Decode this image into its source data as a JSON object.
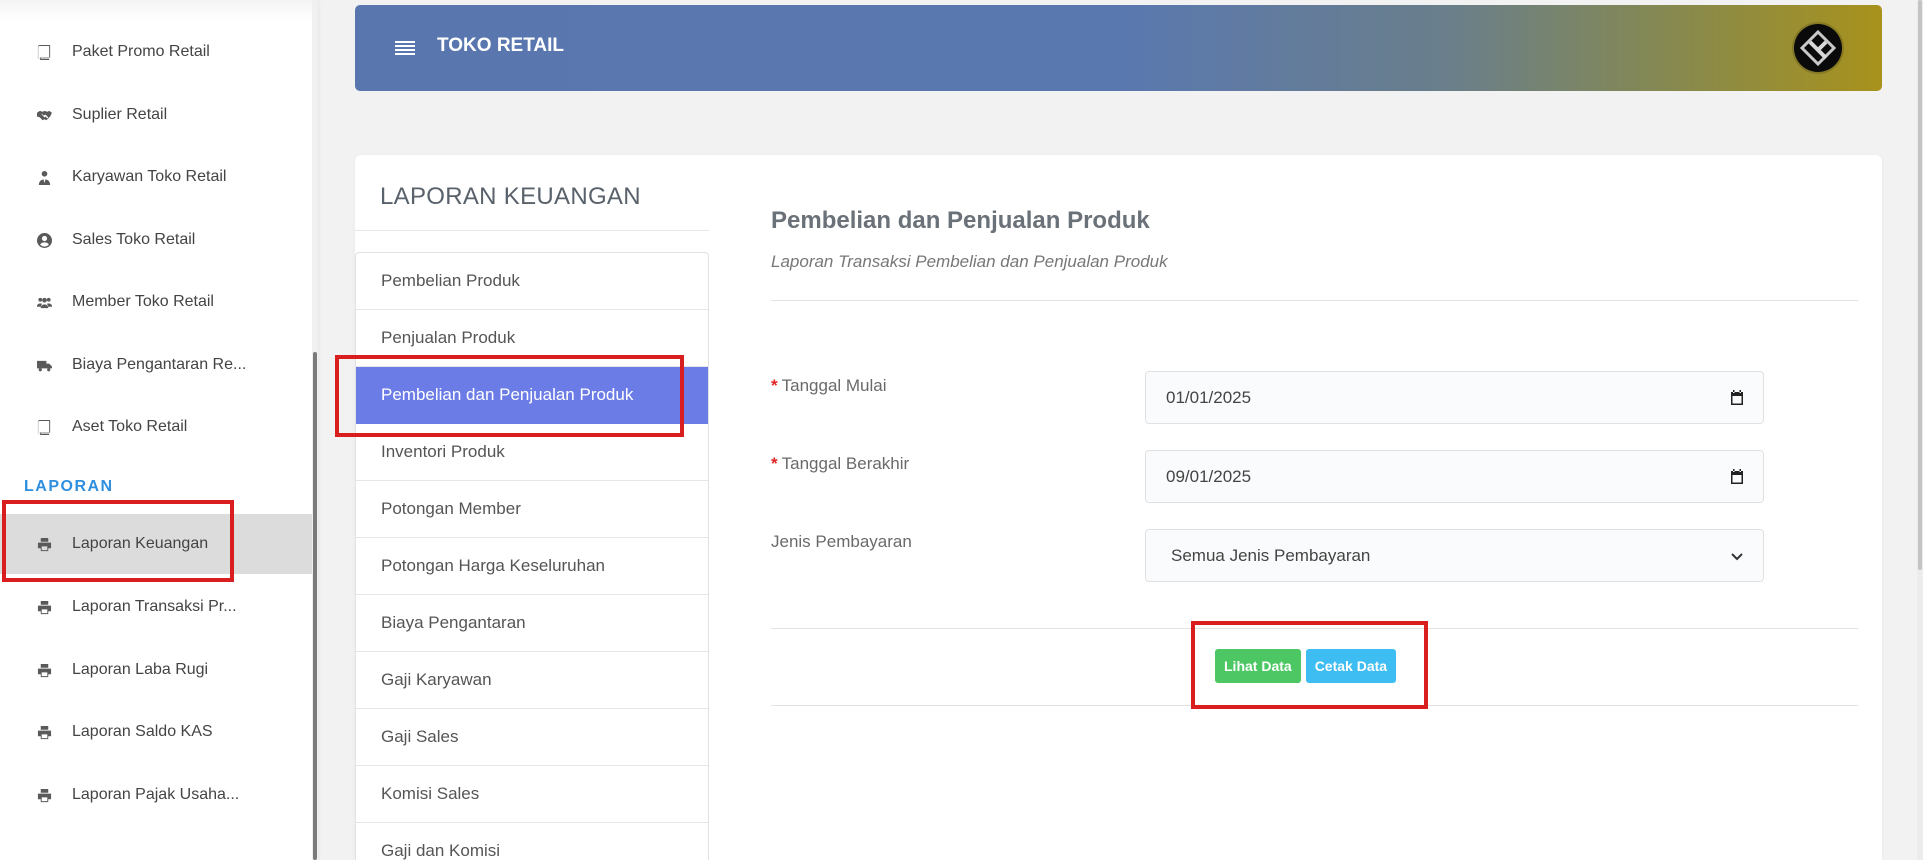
{
  "sidebar": {
    "items": [
      {
        "label": "Paket Promo Retail",
        "icon": "book-icon"
      },
      {
        "label": "Suplier Retail",
        "icon": "handshake-icon"
      },
      {
        "label": "Karyawan Toko Retail",
        "icon": "user-tie-icon"
      },
      {
        "label": "Sales Toko Retail",
        "icon": "user-circle-icon"
      },
      {
        "label": "Member Toko Retail",
        "icon": "users-icon"
      },
      {
        "label": "Biaya Pengantaran Re...",
        "icon": "truck-icon"
      },
      {
        "label": "Aset Toko Retail",
        "icon": "book-icon"
      }
    ],
    "section_title": "LAPORAN",
    "report_items": [
      {
        "label": "Laporan Keuangan",
        "icon": "print-icon",
        "active": true
      },
      {
        "label": "Laporan Transaksi Pr...",
        "icon": "print-icon"
      },
      {
        "label": "Laporan Laba Rugi",
        "icon": "print-icon"
      },
      {
        "label": "Laporan Saldo KAS",
        "icon": "print-icon"
      },
      {
        "label": "Laporan Pajak Usaha...",
        "icon": "print-icon"
      }
    ]
  },
  "header": {
    "title": "TOKO RETAIL",
    "menu_icon": "hamburger-icon",
    "avatar_icon": "logo-avatar-icon"
  },
  "card": {
    "title": "LAPORAN KEUANGAN",
    "menu": [
      "Pembelian Produk",
      "Penjualan Produk",
      "Pembelian dan Penjualan Produk",
      "Inventori Produk",
      "Potongan Member",
      "Potongan Harga Keseluruhan",
      "Biaya Pengantaran",
      "Gaji Karyawan",
      "Gaji Sales",
      "Komisi Sales",
      "Gaji dan Komisi"
    ],
    "active_menu": "Pembelian dan Penjualan Produk"
  },
  "form": {
    "title": "Pembelian dan Penjualan Produk",
    "subtitle": "Laporan Transaksi Pembelian dan Penjualan Produk",
    "required_mark": "*",
    "start_label": "Tanggal Mulai",
    "start_value": "01/01/2025",
    "end_label": "Tanggal Berakhir",
    "end_value": "09/01/2025",
    "payment_label": "Jenis Pembayaran",
    "payment_value": "Semua Jenis Pembayaran",
    "view_button": "Lihat Data",
    "print_button": "Cetak Data"
  },
  "colors": {
    "accent": "#6c7ce6",
    "section": "#2f8fde",
    "highlight": "#d81e1e",
    "btn_green": "#4cc764",
    "btn_blue": "#3ebdf2"
  }
}
